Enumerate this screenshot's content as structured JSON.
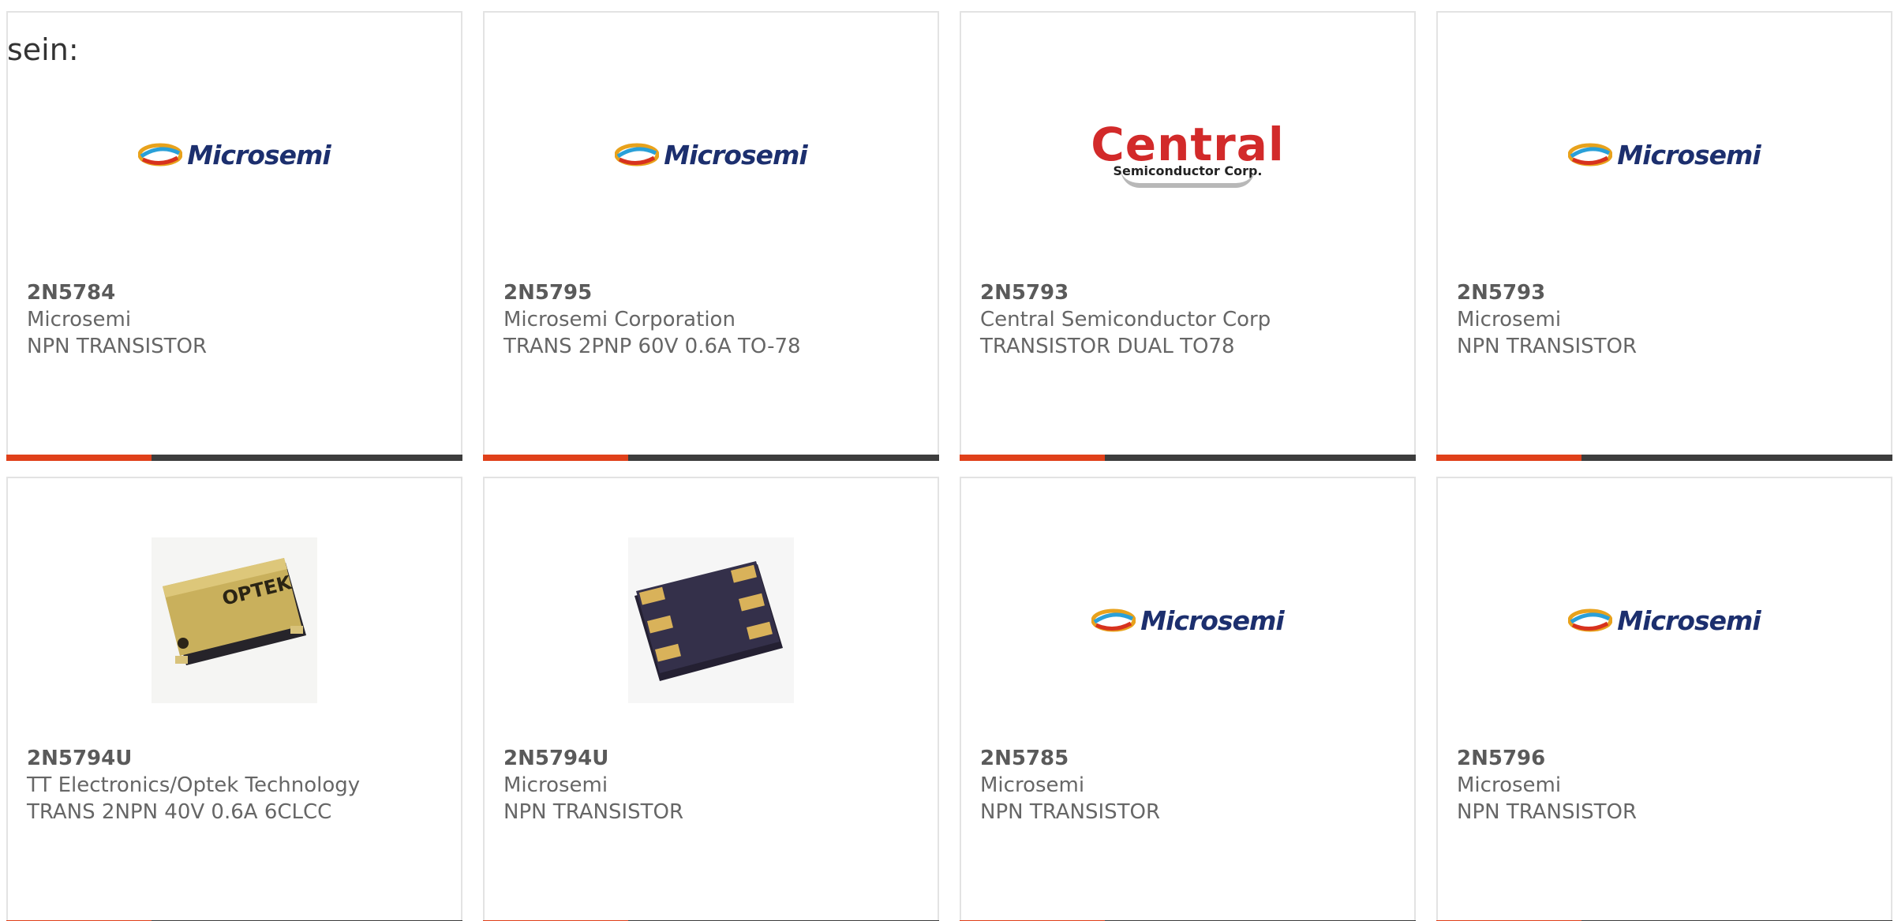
{
  "intro_text": "sein:",
  "colors": {
    "accent": "#e0401a",
    "bar": "#3d3d3d",
    "border": "#e3e3e3",
    "text": "#666666"
  },
  "cards": [
    {
      "part": "2N5784",
      "manufacturer": "Microsemi",
      "description": "NPN TRANSISTOR",
      "image": "microsemi-logo"
    },
    {
      "part": "2N5795",
      "manufacturer": "Microsemi Corporation",
      "description": "TRANS 2PNP 60V 0.6A TO-78",
      "image": "microsemi-logo"
    },
    {
      "part": "2N5793",
      "manufacturer": "Central Semiconductor Corp",
      "description": "TRANSISTOR DUAL TO78",
      "image": "central-semiconductor-logo"
    },
    {
      "part": "2N5793",
      "manufacturer": "Microsemi",
      "description": "NPN TRANSISTOR",
      "image": "microsemi-logo"
    },
    {
      "part": "2N5794U",
      "manufacturer": "TT Electronics/Optek Technology",
      "description": "TRANS 2NPN 40V 0.6A 6CLCC",
      "image": "optek-gold-package-photo"
    },
    {
      "part": "2N5794U",
      "manufacturer": "Microsemi",
      "description": "NPN TRANSISTOR",
      "image": "black-smd-package-photo"
    },
    {
      "part": "2N5785",
      "manufacturer": "Microsemi",
      "description": "NPN TRANSISTOR",
      "image": "microsemi-logo"
    },
    {
      "part": "2N5796",
      "manufacturer": "Microsemi",
      "description": "NPN TRANSISTOR",
      "image": "microsemi-logo"
    }
  ],
  "logos": {
    "microsemi": "Microsemi",
    "central_main": "Central",
    "central_sub": "Semiconductor Corp.",
    "optek_marking": "OPTEK"
  }
}
